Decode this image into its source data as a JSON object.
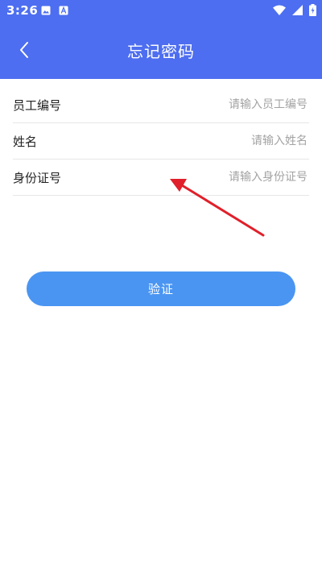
{
  "status_bar": {
    "time": "3:26",
    "icons": [
      "image-icon",
      "font-a-icon",
      "wifi-icon",
      "signal-icon",
      "battery-charging-icon"
    ]
  },
  "header": {
    "title": "忘记密码",
    "back_icon": "chevron-left-icon",
    "background_color": "#4d6ef0"
  },
  "form": {
    "fields": [
      {
        "label": "员工编号",
        "placeholder": "请输入员工编号",
        "value": ""
      },
      {
        "label": "姓名",
        "placeholder": "请输入姓名",
        "value": ""
      },
      {
        "label": "身份证号",
        "placeholder": "请输入身份证号",
        "value": ""
      }
    ]
  },
  "verify_button": {
    "label": "验证",
    "color": "#4a95f2"
  },
  "annotation": {
    "color": "#e0202a",
    "icon": "red-arrow-annotation"
  }
}
